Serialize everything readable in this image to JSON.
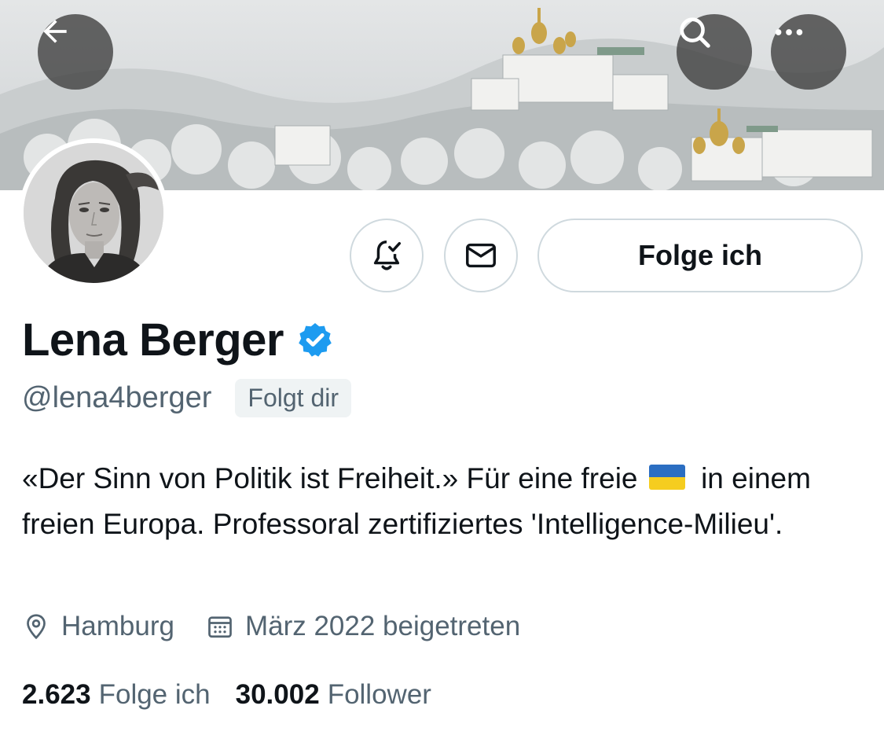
{
  "header": {
    "back_icon": "arrow-left-icon",
    "search_icon": "search-icon",
    "more_icon": "ellipsis-icon"
  },
  "profile": {
    "display_name": "Lena Berger",
    "verified_color": "#1d9bf0",
    "handle": "@lena4berger",
    "follows_you_badge": "Folgt dir",
    "follow_button_label": "Folge ich"
  },
  "bio": {
    "part1": "«Der Sinn von Politik ist Freiheit.» Für eine freie",
    "flag": "ukraine-flag",
    "part2": "in einem freien Europa. Professoral zertifiziertes 'Intelligence-Milieu'."
  },
  "meta": {
    "location": "Hamburg",
    "joined": "März 2022 beigetreten"
  },
  "stats": {
    "following_count": "2.623",
    "following_label": "Folge ich",
    "followers_count": "30.002",
    "followers_label": "Follower"
  }
}
